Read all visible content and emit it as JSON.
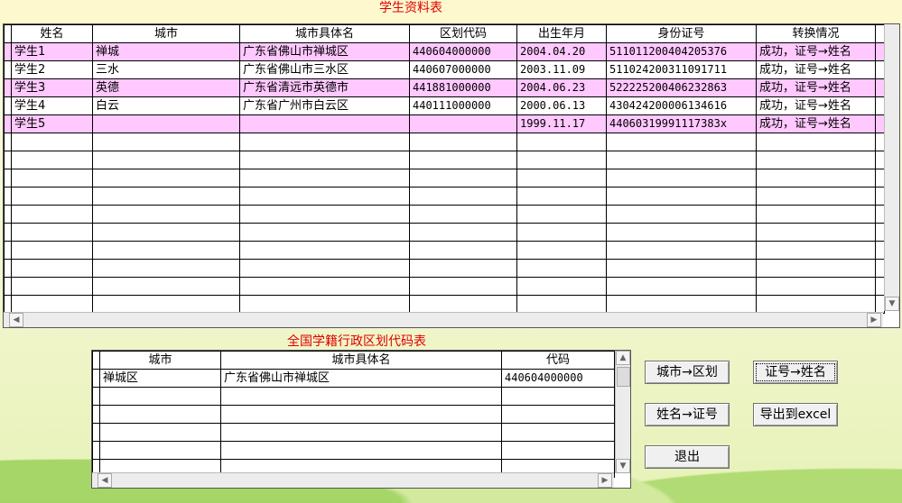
{
  "student_title": "学生资料表",
  "student_headers": [
    "姓名",
    "城市",
    "城市具体名",
    "区划代码",
    "出生年月",
    "身份证号",
    "转换情况"
  ],
  "students": [
    [
      "学生1",
      "禅城",
      "广东省佛山市禅城区",
      "440604000000",
      "2004.04.20",
      "511011200404205376",
      "成功，证号→姓名"
    ],
    [
      "学生2",
      "三水",
      "广东省佛山市三水区",
      "440607000000",
      "2003.11.09",
      "511024200311091711",
      "成功，证号→姓名"
    ],
    [
      "学生3",
      "英德",
      "广东省清远市英德市",
      "441881000000",
      "2004.06.23",
      "522225200406232863",
      "成功，证号→姓名"
    ],
    [
      "学生4",
      "白云",
      "广东省广州市白云区",
      "440111000000",
      "2000.06.13",
      "430424200006134616",
      "成功，证号→姓名"
    ],
    [
      "学生5",
      "",
      "",
      "",
      "1999.11.17",
      "44060319991117383x",
      "成功，证号→姓名"
    ]
  ],
  "code_title": "全国学籍行政区划代码表",
  "code_headers": [
    "城市",
    "城市具体名",
    "代码"
  ],
  "codes": [
    [
      "禅城区",
      "广东省佛山市禅城区",
      "440604000000"
    ]
  ],
  "buttons": {
    "city_to_district": "城市→区划",
    "id_to_name": "证号→姓名",
    "name_to_id": "姓名→证号",
    "export_excel": "导出到excel",
    "exit": "退出"
  },
  "icons": {
    "scroll_left": "triangle-left",
    "scroll_right": "triangle-right",
    "scroll_up": "triangle-up",
    "scroll_down": "triangle-down"
  }
}
